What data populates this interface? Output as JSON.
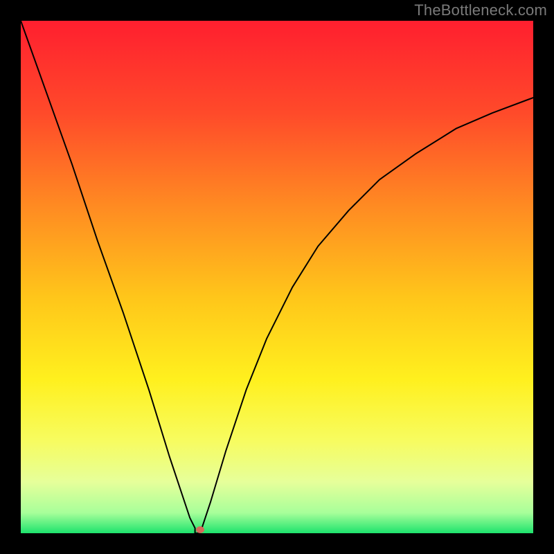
{
  "watermark": "TheBottleneck.com",
  "chart_data": {
    "type": "line",
    "title": "",
    "xlabel": "",
    "ylabel": "",
    "xlim": [
      0,
      100
    ],
    "ylim": [
      0,
      100
    ],
    "background_gradient": {
      "stops": [
        {
          "offset": 0.0,
          "color": "#ff1f2f"
        },
        {
          "offset": 0.18,
          "color": "#ff4a2a"
        },
        {
          "offset": 0.36,
          "color": "#ff8a22"
        },
        {
          "offset": 0.54,
          "color": "#ffc61a"
        },
        {
          "offset": 0.7,
          "color": "#fff01e"
        },
        {
          "offset": 0.82,
          "color": "#f7fc60"
        },
        {
          "offset": 0.9,
          "color": "#e6ff9a"
        },
        {
          "offset": 0.96,
          "color": "#a8ff9a"
        },
        {
          "offset": 1.0,
          "color": "#1de36d"
        }
      ]
    },
    "series": [
      {
        "name": "bottleneck-curve",
        "stroke": "#000000",
        "stroke_width": 2,
        "x": [
          0,
          5,
          10,
          15,
          20,
          25,
          29,
          31,
          33,
          34,
          34,
          35,
          37,
          40,
          44,
          48,
          53,
          58,
          64,
          70,
          77,
          85,
          92,
          100
        ],
        "y": [
          100,
          86,
          72,
          57,
          43,
          28,
          15,
          9,
          3,
          1,
          0,
          0,
          6,
          16,
          28,
          38,
          48,
          56,
          63,
          69,
          74,
          79,
          82,
          85
        ]
      }
    ],
    "marker": {
      "name": "min-point",
      "x": 35,
      "y": 0,
      "rx": 6,
      "ry": 5,
      "fill": "#d66a5a"
    }
  }
}
